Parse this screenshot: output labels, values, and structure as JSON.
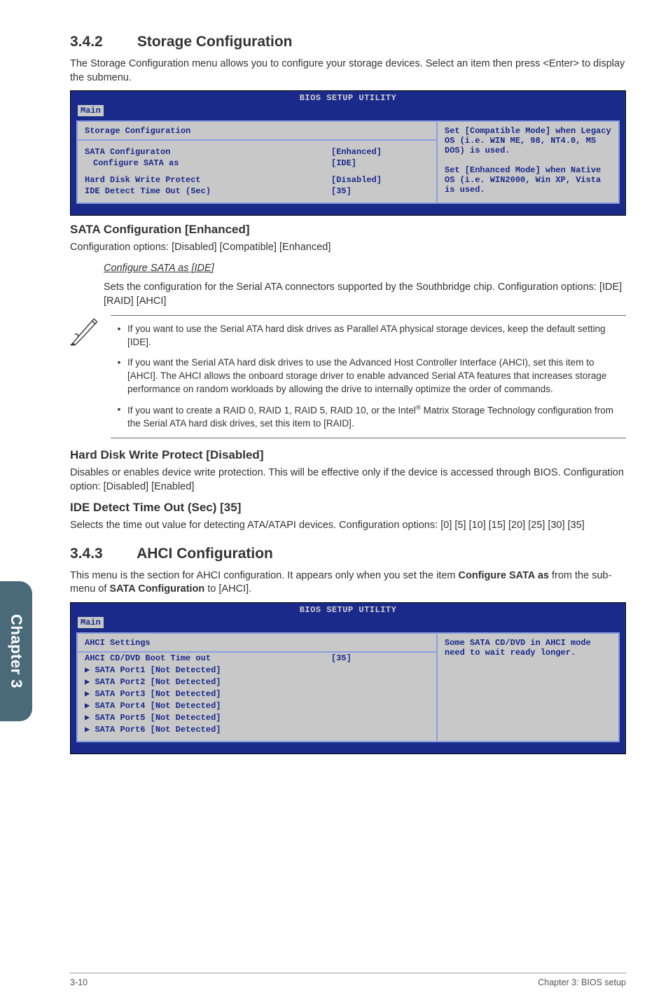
{
  "section_a": {
    "num": "3.4.2",
    "title": "Storage Configuration",
    "intro": "The Storage Configuration menu allows you to configure your storage devices. Select an item then press <Enter> to display the submenu."
  },
  "bios1": {
    "title": "BIOS SETUP UTILITY",
    "tab": "Main",
    "group_title": "Storage Configuration",
    "rows": [
      {
        "k": "SATA Configuraton",
        "v": "[Enhanced]",
        "indent": false
      },
      {
        "k": "Configure SATA as",
        "v": "[IDE]",
        "indent": true
      },
      {
        "k": "GAP"
      },
      {
        "k": "Hard Disk Write Protect",
        "v": "[Disabled]",
        "indent": false
      },
      {
        "k": "IDE Detect Time Out (Sec)",
        "v": "[35]",
        "indent": false
      }
    ],
    "right_text": "Set [Compatible Mode] when Legacy OS (i.e. WIN ME, 98, NT4.0, MS DOS) is used.\n\nSet [Enhanced Mode] when Native OS (i.e. WIN2000, Win XP, Vista is used."
  },
  "sata_conf": {
    "heading": "SATA Configuration [Enhanced]",
    "line": "Configuration options: [Disabled] [Compatible] [Enhanced]",
    "sub_head": "Configure SATA as [IDE]",
    "sub_p1": "Sets the configuration for the Serial ATA connectors supported by the Southbridge chip. Configuration options: [IDE] [RAID] [AHCI]"
  },
  "notes": {
    "n1": "If you want to use the Serial ATA hard disk drives as Parallel ATA physical storage devices, keep the default setting [IDE].",
    "n2": "If you want the Serial ATA hard disk drives to use the Advanced Host Controller Interface (AHCI), set this item to [AHCI]. The AHCI allows the onboard storage driver to enable advanced Serial ATA features that increases storage performance on random workloads by allowing the drive to internally optimize the order of commands.",
    "n3_a": "If you want to create a RAID 0, RAID 1, RAID 5, RAID 10, or the Intel",
    "n3_sup": "®",
    "n3_b": " Matrix Storage Technology configuration from the Serial ATA hard disk drives, set this item to [RAID]."
  },
  "hdwp": {
    "heading": "Hard Disk Write Protect [Disabled]",
    "body": "Disables or enables device write protection. This will be effective only if the device is accessed through BIOS. Configuration option: [Disabled] [Enabled]"
  },
  "ide_to": {
    "heading": "IDE Detect Time Out (Sec) [35]",
    "body": "Selects the time out value for detecting ATA/ATAPI devices. Configuration options: [0] [5] [10] [15] [20] [25] [30] [35]"
  },
  "section_b": {
    "num": "3.4.3",
    "title": "AHCI Configuration",
    "intro_a": "This menu is the section for AHCI configuration. It appears only when you set the item ",
    "intro_b1": "Configure SATA as",
    "intro_c": " from the sub-menu of ",
    "intro_b2": "SATA Configuration",
    "intro_d": " to [AHCI]."
  },
  "bios2": {
    "title": "BIOS SETUP UTILITY",
    "tab": "Main",
    "group_title": "AHCI Settings",
    "rows": [
      {
        "k": "AHCI CD/DVD Boot Time out",
        "v": "[35]",
        "plain": true
      },
      {
        "k": "SATA Port1 [Not Detected]",
        "v": "",
        "sub": true
      },
      {
        "k": "SATA Port2 [Not Detected]",
        "v": "",
        "sub": true
      },
      {
        "k": "SATA Port3 [Not Detected]",
        "v": "",
        "sub": true
      },
      {
        "k": "SATA Port4 [Not Detected]",
        "v": "",
        "sub": true
      },
      {
        "k": "SATA Port5 [Not Detected]",
        "v": "",
        "sub": true
      },
      {
        "k": "SATA Port6 [Not Detected]",
        "v": "",
        "sub": true
      }
    ],
    "right_text": "Some SATA CD/DVD in AHCI mode need to wait ready longer."
  },
  "side_tab": "Chapter 3",
  "footer": {
    "left": "3-10",
    "right": "Chapter 3: BIOS setup"
  }
}
